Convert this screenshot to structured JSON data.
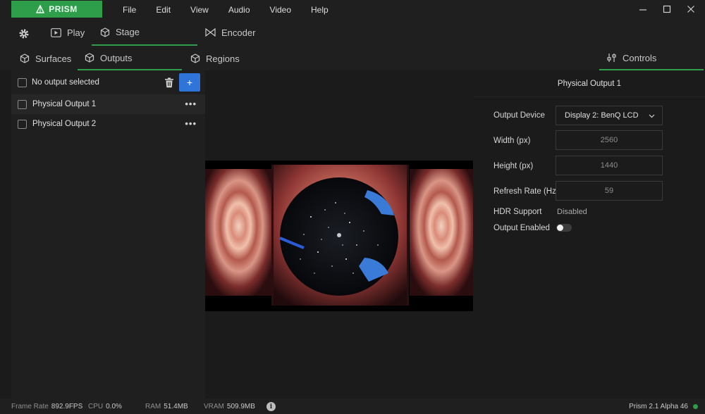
{
  "app": {
    "brand": "PRISM",
    "version": "Prism 2.1 Alpha 46"
  },
  "menu": [
    "File",
    "Edit",
    "View",
    "Audio",
    "Video",
    "Help"
  ],
  "main_tabs": {
    "play": "Play",
    "stage": "Stage",
    "encoder": "Encoder"
  },
  "sub_tabs": {
    "surfaces": "Surfaces",
    "outputs": "Outputs",
    "regions": "Regions",
    "controls": "Controls"
  },
  "outputs_panel": {
    "header": "No output selected",
    "add_label": "+",
    "items": [
      {
        "label": "Physical Output 1",
        "selected": true
      },
      {
        "label": "Physical Output 2",
        "selected": false
      }
    ],
    "item_menu": "•••"
  },
  "controls": {
    "title": "Physical Output 1",
    "output_device_label": "Output Device",
    "output_device_value": "Display 2: BenQ LCD",
    "width_label": "Width (px)",
    "width_value": "2560",
    "height_label": "Height (px)",
    "height_value": "1440",
    "refresh_label": "Refresh Rate (Hz)",
    "refresh_value": "59",
    "hdr_label": "HDR Support",
    "hdr_value": "Disabled",
    "enabled_label": "Output Enabled",
    "enabled": false
  },
  "status": {
    "frame_rate_label": "Frame Rate",
    "frame_rate": "892.9FPS",
    "cpu_label": "CPU",
    "cpu": "0.0%",
    "ram_label": "RAM",
    "ram": "51.4MB",
    "vram_label": "VRAM",
    "vram": "509.9MB",
    "info": "i"
  },
  "colors": {
    "accent": "#2e9e4a",
    "primary_button": "#2f74d8",
    "background": "#1b1b1b"
  },
  "icons": [
    "prism-logo-icon",
    "gear-icon",
    "play-icon",
    "cube-icon",
    "bowtie-icon",
    "trash-icon",
    "chevron-down-icon",
    "sliders-icon",
    "info-icon",
    "minimize-icon",
    "maximize-icon",
    "close-icon"
  ]
}
